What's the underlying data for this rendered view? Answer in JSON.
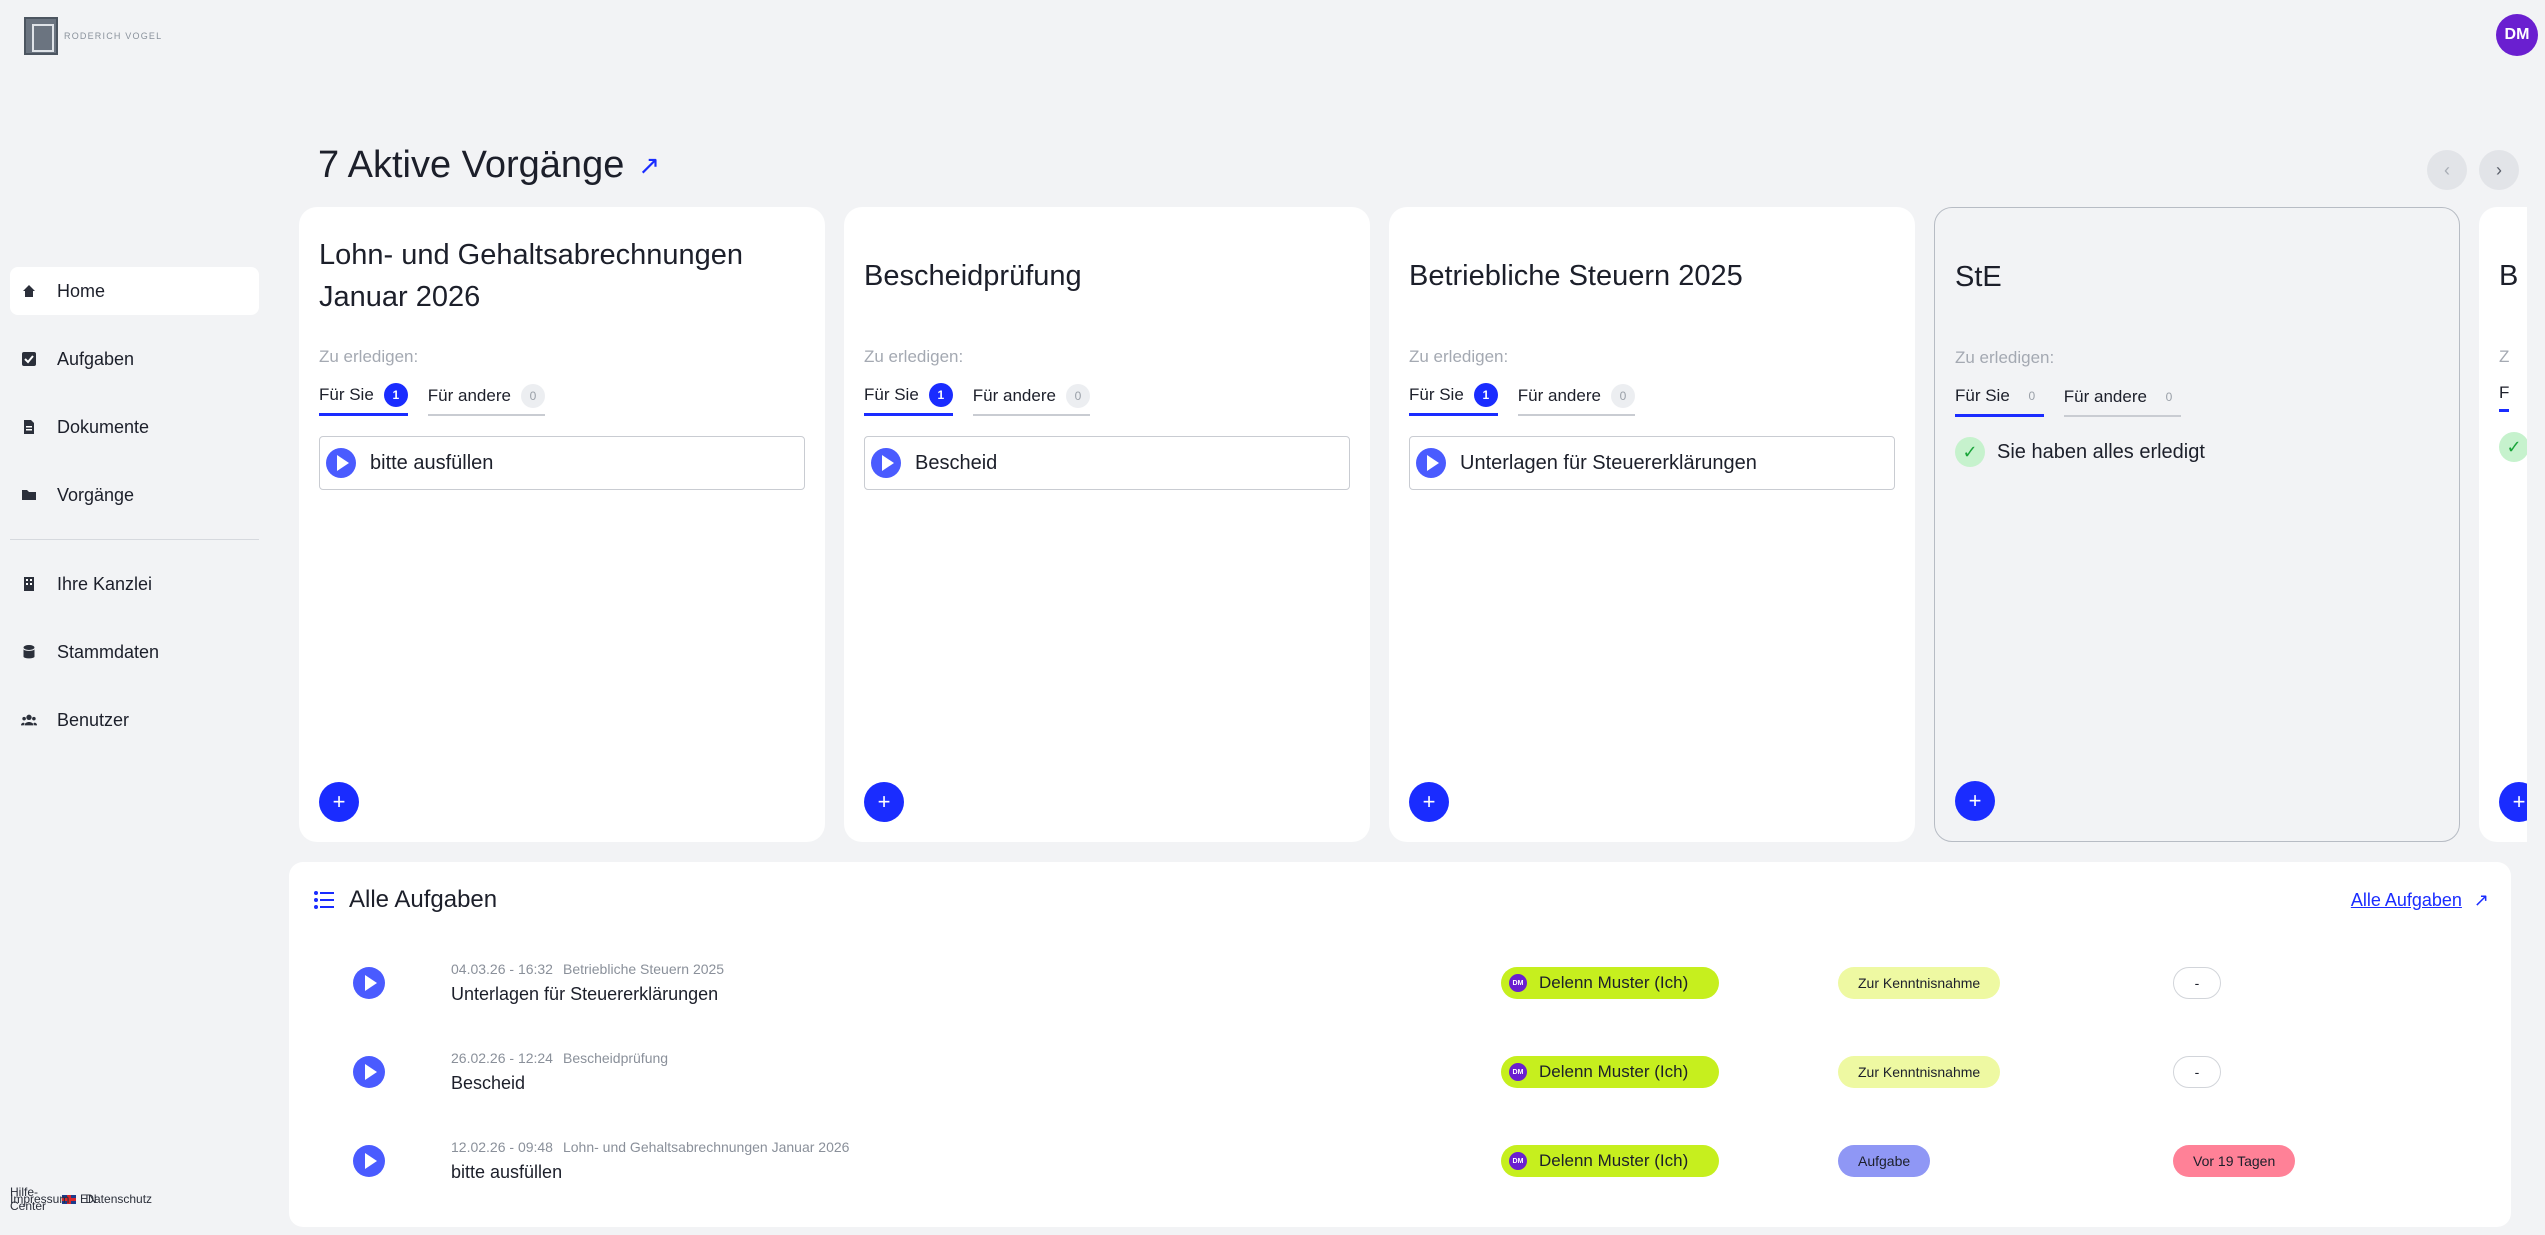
{
  "brand": {
    "logo_text": "RODERICH VOGEL"
  },
  "user": {
    "initials": "DM"
  },
  "sidebar": {
    "items": [
      {
        "label": "Home",
        "icon": "home-icon",
        "active": true
      },
      {
        "label": "Aufgaben",
        "icon": "checkbox-icon"
      },
      {
        "label": "Dokumente",
        "icon": "document-icon"
      },
      {
        "label": "Vorgänge",
        "icon": "folder-icon"
      },
      {
        "label": "Ihre Kanzlei",
        "icon": "building-icon"
      },
      {
        "label": "Stammdaten",
        "icon": "database-icon"
      },
      {
        "label": "Benutzer",
        "icon": "users-icon"
      }
    ],
    "footer": {
      "help": "Hilfe-Center",
      "lang": "EN",
      "imprint": "Impressum",
      "privacy": "Datenschutz"
    }
  },
  "header": {
    "title": "7 Aktive Vorgänge",
    "prev": "‹",
    "next": "›"
  },
  "cards": [
    {
      "title": "Lohn- und Gehaltsabrechnungen Januar 2026",
      "todo_label": "Zu erledigen:",
      "tab_you": "Für Sie",
      "tab_you_count": "1",
      "tab_others": "Für andere",
      "tab_others_count": "0",
      "task": "bitte ausfüllen"
    },
    {
      "title": "Bescheidprüfung",
      "todo_label": "Zu erledigen:",
      "tab_you": "Für Sie",
      "tab_you_count": "1",
      "tab_others": "Für andere",
      "tab_others_count": "0",
      "task": "Bescheid"
    },
    {
      "title": "Betriebliche Steuern 2025",
      "todo_label": "Zu erledigen:",
      "tab_you": "Für Sie",
      "tab_you_count": "1",
      "tab_others": "Für andere",
      "tab_others_count": "0",
      "task": "Unterlagen für Steuererklärungen"
    },
    {
      "title": "StE",
      "todo_label": "Zu erledigen:",
      "tab_you": "Für Sie",
      "tab_you_count": "0",
      "tab_others": "Für andere",
      "tab_others_count": "0",
      "done": "Sie haben alles erledigt"
    },
    {
      "title": "B",
      "todo_label": "Z",
      "tab_you": "F"
    }
  ],
  "tasks_panel": {
    "title": "Alle Aufgaben",
    "link": "Alle Aufgaben",
    "rows": [
      {
        "date": "04.03.26 - 16:32",
        "process": "Betriebliche Steuern 2025",
        "name": "Unterlagen für Steuererklärungen",
        "assignee": "Delenn Muster (Ich)",
        "type": "Zur Kenntnisnahme",
        "due": "-"
      },
      {
        "date": "26.02.26 - 12:24",
        "process": "Bescheidprüfung",
        "name": "Bescheid",
        "assignee": "Delenn Muster (Ich)",
        "type": "Zur Kenntnisnahme",
        "due": "-"
      },
      {
        "date": "12.02.26 - 09:48",
        "process": "Lohn- und Gehaltsabrechnungen Januar 2026",
        "name": "bitte ausfüllen",
        "assignee": "Delenn Muster (Ich)",
        "type": "Aufgabe",
        "due": "Vor 19 Tagen"
      }
    ]
  },
  "colors": {
    "accent": "#1a2cff",
    "assignee_bg": "#c6ef1e",
    "info_pill": "#eef9a2",
    "task_pill": "#8f97f5",
    "overdue": "#ff8197",
    "avatar": "#6a1fd0"
  }
}
